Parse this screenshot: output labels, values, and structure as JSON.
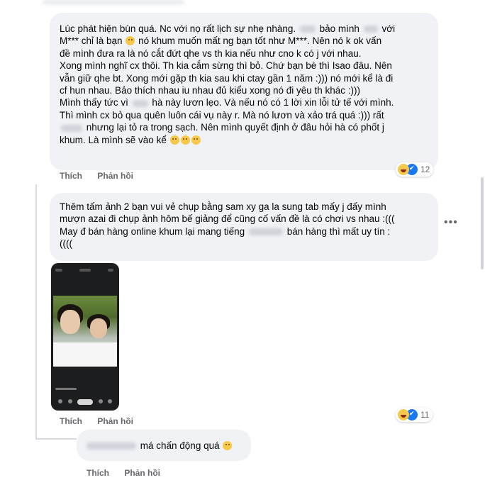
{
  "comments": [
    {
      "lines": [
        [
          "Lúc phát hiện bùn quá. Nc với nọ rất lịch sự nhẹ nhàng.",
          "bảo mình",
          "với"
        ],
        [
          "M*** chỉ là bạn",
          "nó khum muốn mất ng bạn tốt như M***. Nên nó k ok vấn"
        ],
        [
          "đề mình đưa ra là nó cắt đứt qhe vs th kia nếu như cno k có j với nhau."
        ],
        [
          "Xong mình nghĩ cx thôi. Th kia cắm sừng thì bỏ. Chứ bạn bè thì Isao đâu. Nên"
        ],
        [
          "vẫn giữ qhe bt. Xong mới gặp th kia sau khi ctay gần 1 năm :))) nó mới kể là đi"
        ],
        [
          "cf hun nhau. Bảo thích nhau iu nhau đủ kiểu xong nó đi yêu th khác :)))"
        ],
        [
          "Mình thấy tức vì",
          "hà này lươn lẹo. Và nếu nó có 1 lời xin lỗi tử tế với mình."
        ],
        [
          "Thì mình cx bỏ qua quên luôn cái vụ này r. Mà nó lươn và xảo trá quá :))) rất"
        ],
        [
          "",
          "nhưng lại tỏ ra trong sạch. Nên mình quyết định ở đâu hỏi hà có phốt j"
        ],
        [
          "khum. Là mình sẽ vào kể"
        ]
      ],
      "actions": {
        "like": "Thích",
        "reply": "Phản hồi"
      },
      "reaction_count": "12",
      "reactions": [
        "haha-icon",
        "like-icon"
      ]
    },
    {
      "lines": [
        [
          "Thêm tấm ảnh 2 bạn vui vẻ chụp bằng sam xy ga la sung tab mấy j đấy mình"
        ],
        [
          "mượn azai đi chụp ảnh hôm bế giảng để cũng cố vấn đề là có chơi vs nhau :((("
        ],
        [
          "May đ bán hàng online khum lại mang tiếng",
          "bán hàng thì mất uy tín :"
        ],
        [
          "(((("
        ]
      ],
      "more": "•••",
      "actions": {
        "like": "Thích",
        "reply": "Phản hồi"
      },
      "reaction_count": "11",
      "reactions": [
        "haha-icon",
        "like-icon"
      ]
    },
    {
      "text": "má chấn động quá",
      "actions": {
        "like": "Thích",
        "reply": "Phản hồi"
      }
    }
  ]
}
